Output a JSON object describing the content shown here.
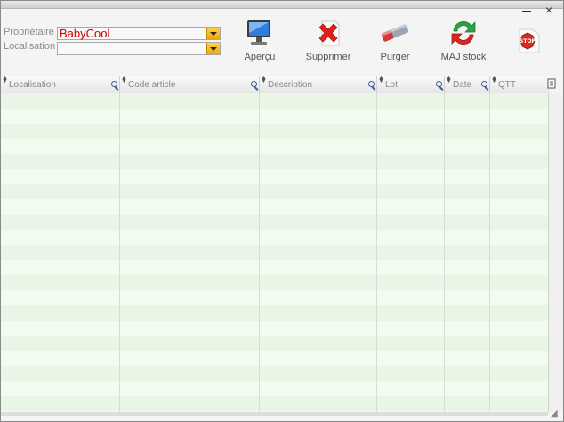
{
  "window": {
    "minimize_icon": "minimize-icon",
    "close_icon": "close-icon",
    "close_glyph": "×"
  },
  "filters": {
    "owner_label": "Propriétaire",
    "owner_value": "BabyCool",
    "location_label": "Localisation",
    "location_value": ""
  },
  "toolbar": {
    "preview_label": "Aperçu",
    "delete_label": "Supprimer",
    "purge_label": "Purger",
    "update_stock_label": "MAJ stock"
  },
  "table": {
    "columns": [
      "Localisation",
      "Code article",
      "Description",
      "Lot",
      "Date",
      "QTT"
    ],
    "column_menu_icon": "column-menu-icon"
  },
  "colors": {
    "row_even": "#e9f6e6",
    "row_odd": "#f2fbf0",
    "accent": "#f0a500",
    "owner_text": "#cc0000"
  }
}
